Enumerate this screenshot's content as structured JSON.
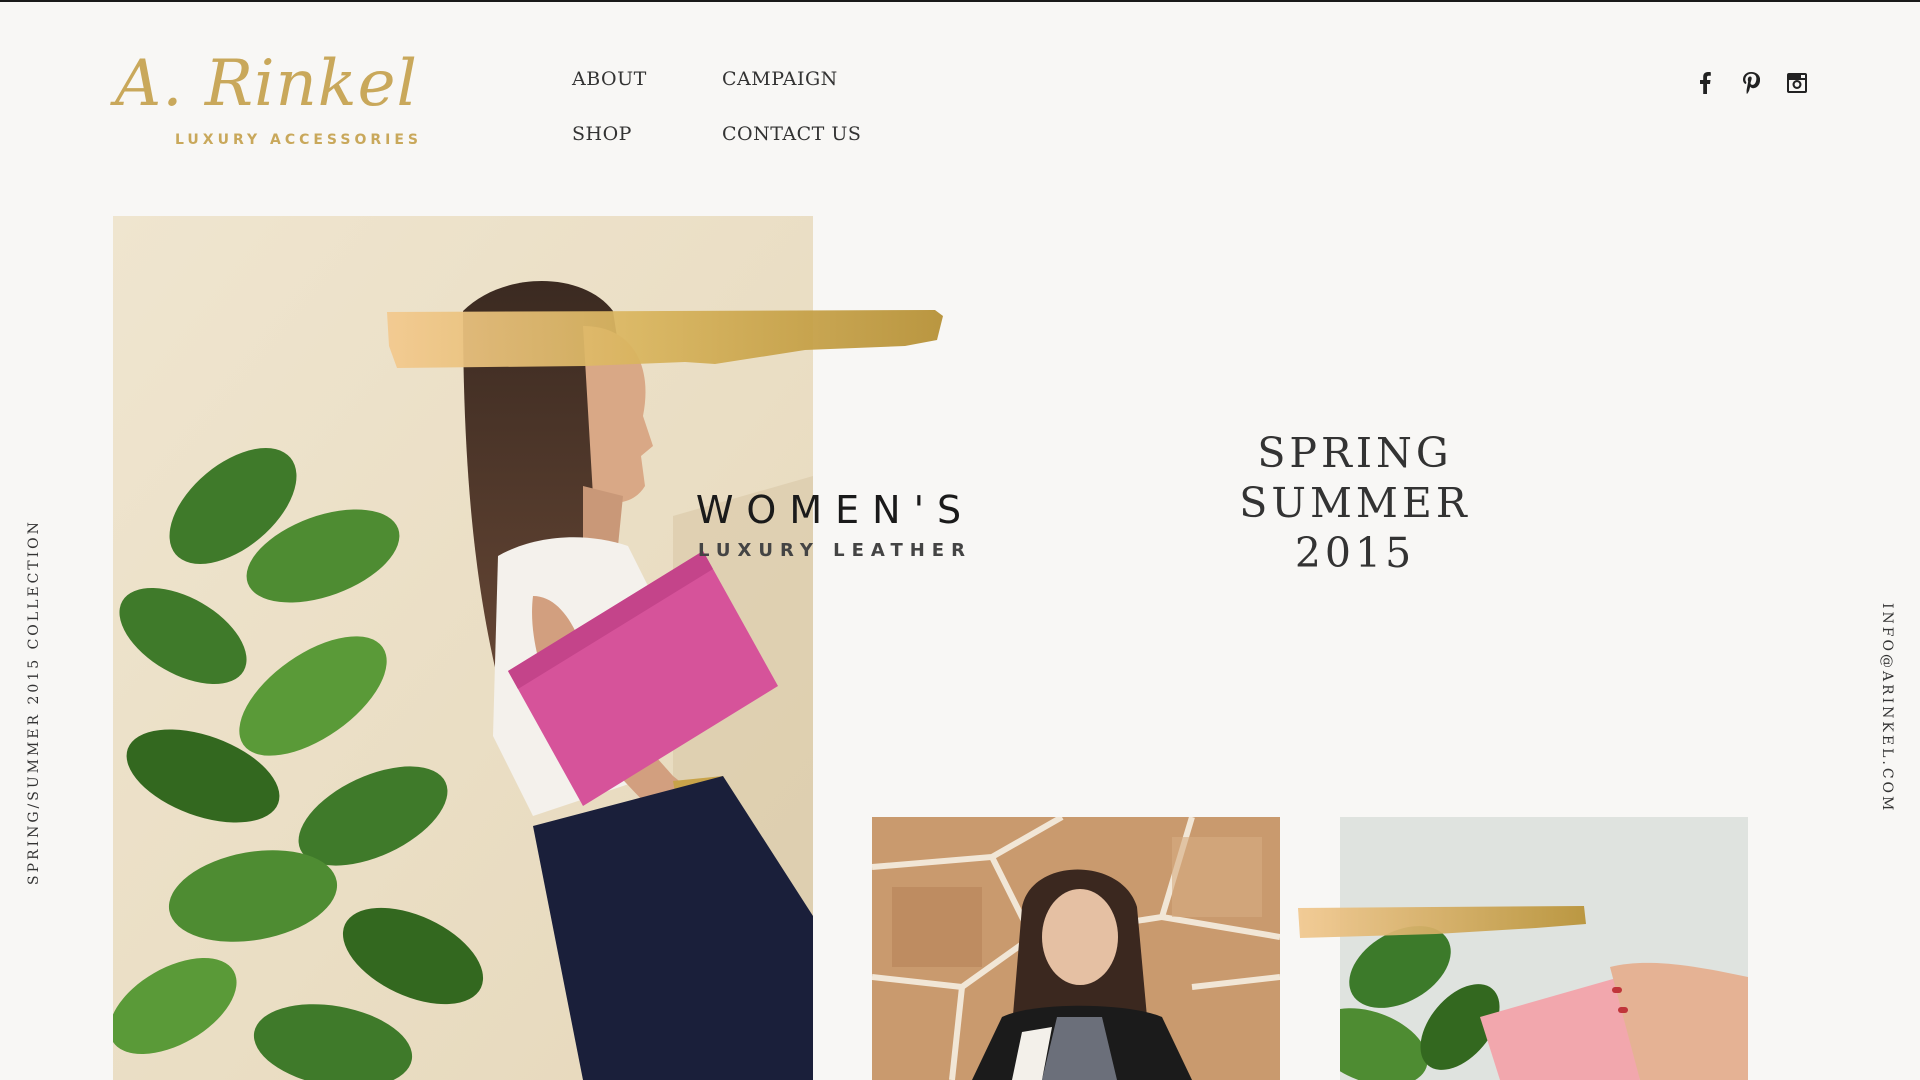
{
  "brand": {
    "logo_script": "A. Rinkel",
    "logo_sub": "LUXURY ACCESSORIES",
    "gold": "#c9a85b"
  },
  "nav": {
    "items": [
      {
        "label": "ABOUT"
      },
      {
        "label": "CAMPAIGN"
      },
      {
        "label": "SHOP"
      },
      {
        "label": "CONTACT US"
      }
    ]
  },
  "social": [
    "facebook-icon",
    "pinterest-icon",
    "instagram-icon"
  ],
  "side": {
    "left": "SPRING/SUMMER 2015 COLLECTION",
    "right": "INFO@ARINKEL.COM"
  },
  "hero": {
    "headline": "WOMEN'S",
    "subheadline": "LUXURY LEATHER"
  },
  "season": {
    "line1": "SPRING",
    "line2": "SUMMER",
    "line3": "2015"
  }
}
